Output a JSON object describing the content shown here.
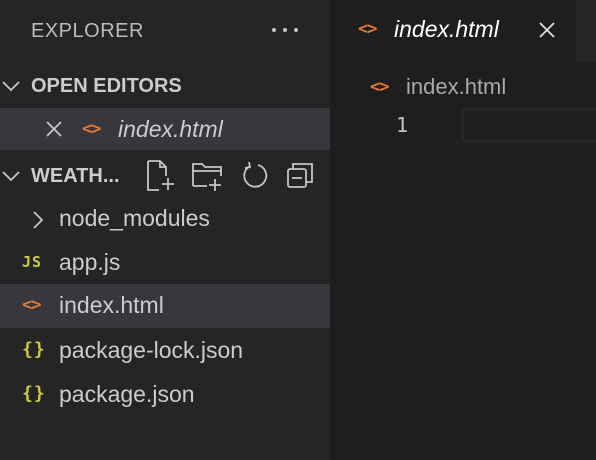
{
  "explorer": {
    "title": "EXPLORER",
    "more_icon": "ellipsis-icon",
    "open_editors": {
      "header": "OPEN EDITORS",
      "files": [
        {
          "name": "index.html",
          "icon": "html-file-icon",
          "icon_glyph": "<>"
        }
      ]
    },
    "workspace": {
      "header": "WEATH...",
      "actions": [
        "new-file-icon",
        "new-folder-icon",
        "refresh-icon",
        "collapse-all-icon"
      ],
      "items": [
        {
          "name": "node_modules",
          "type": "folder"
        },
        {
          "name": "app.js",
          "type": "file",
          "icon": "js-file-icon",
          "icon_glyph": "JS"
        },
        {
          "name": "index.html",
          "type": "file",
          "icon": "html-file-icon",
          "icon_glyph": "<>",
          "selected": true
        },
        {
          "name": "package-lock.json",
          "type": "file",
          "icon": "json-file-icon",
          "icon_glyph": "{}"
        },
        {
          "name": "package.json",
          "type": "file",
          "icon": "json-file-icon",
          "icon_glyph": "{}"
        }
      ]
    }
  },
  "editor": {
    "tab": {
      "label": "index.html",
      "icon_glyph": "<>"
    },
    "breadcrumb": {
      "label": "index.html",
      "icon_glyph": "<>"
    },
    "lines": [
      "1"
    ]
  },
  "colors": {
    "html_icon": "#e37933",
    "json_js_icon": "#cbcb41",
    "sidebar_bg": "#252526",
    "editor_bg": "#1e1e1e",
    "selection_bg": "#37373d"
  }
}
